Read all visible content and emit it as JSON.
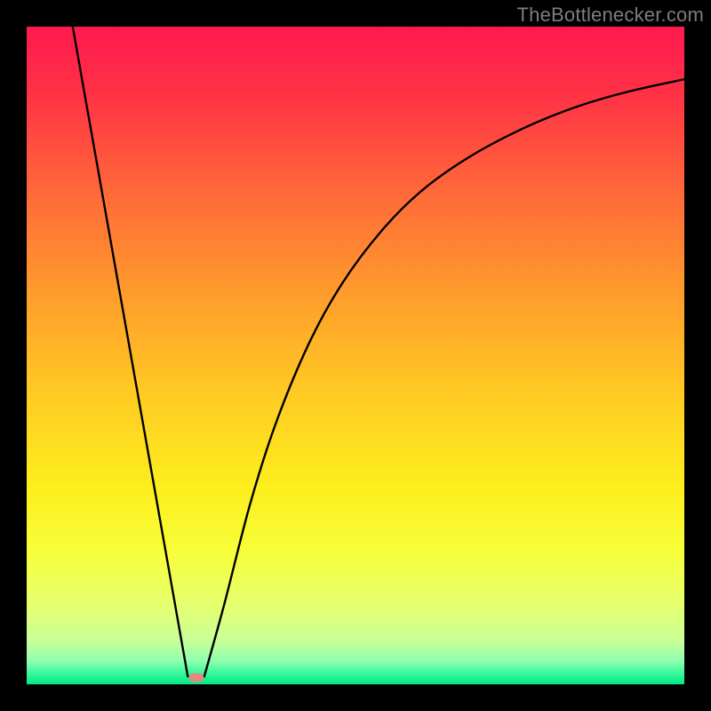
{
  "watermark": "TheBottlenecker.com",
  "chart_data": {
    "type": "line",
    "title": "",
    "xlabel": "",
    "ylabel": "",
    "xlim": [
      0,
      100
    ],
    "ylim": [
      0,
      100
    ],
    "x_minimum": 25,
    "gradient_stops": [
      {
        "offset": 0.0,
        "color": "#ff1a4f"
      },
      {
        "offset": 0.1,
        "color": "#ff3146"
      },
      {
        "offset": 0.25,
        "color": "#ff6839"
      },
      {
        "offset": 0.4,
        "color": "#ff9a2d"
      },
      {
        "offset": 0.55,
        "color": "#ffc823"
      },
      {
        "offset": 0.7,
        "color": "#fdee1d"
      },
      {
        "offset": 0.8,
        "color": "#f7ff3a"
      },
      {
        "offset": 0.88,
        "color": "#e6ff70"
      },
      {
        "offset": 0.935,
        "color": "#c8ff98"
      },
      {
        "offset": 0.965,
        "color": "#8dffb0"
      },
      {
        "offset": 0.985,
        "color": "#30f79a"
      },
      {
        "offset": 1.0,
        "color": "#00e887"
      }
    ],
    "curve_segments": {
      "left": [
        {
          "x": 7.0,
          "y": 100
        },
        {
          "x": 24.5,
          "y": 1.2
        }
      ],
      "right": [
        {
          "x": 27.0,
          "y": 1.2
        },
        {
          "x": 30.0,
          "y": 12.0
        },
        {
          "x": 34.0,
          "y": 27.5
        },
        {
          "x": 38.0,
          "y": 40.0
        },
        {
          "x": 43.0,
          "y": 52.0
        },
        {
          "x": 48.0,
          "y": 61.0
        },
        {
          "x": 54.0,
          "y": 69.0
        },
        {
          "x": 60.0,
          "y": 75.0
        },
        {
          "x": 67.0,
          "y": 80.0
        },
        {
          "x": 75.0,
          "y": 84.3
        },
        {
          "x": 83.0,
          "y": 87.6
        },
        {
          "x": 91.0,
          "y": 90.0
        },
        {
          "x": 100.0,
          "y": 92.0
        }
      ]
    },
    "marker": {
      "x_center": 25.8,
      "y": 1.0,
      "width": 2.2,
      "height": 1.3,
      "color": "#e28a7d"
    }
  }
}
